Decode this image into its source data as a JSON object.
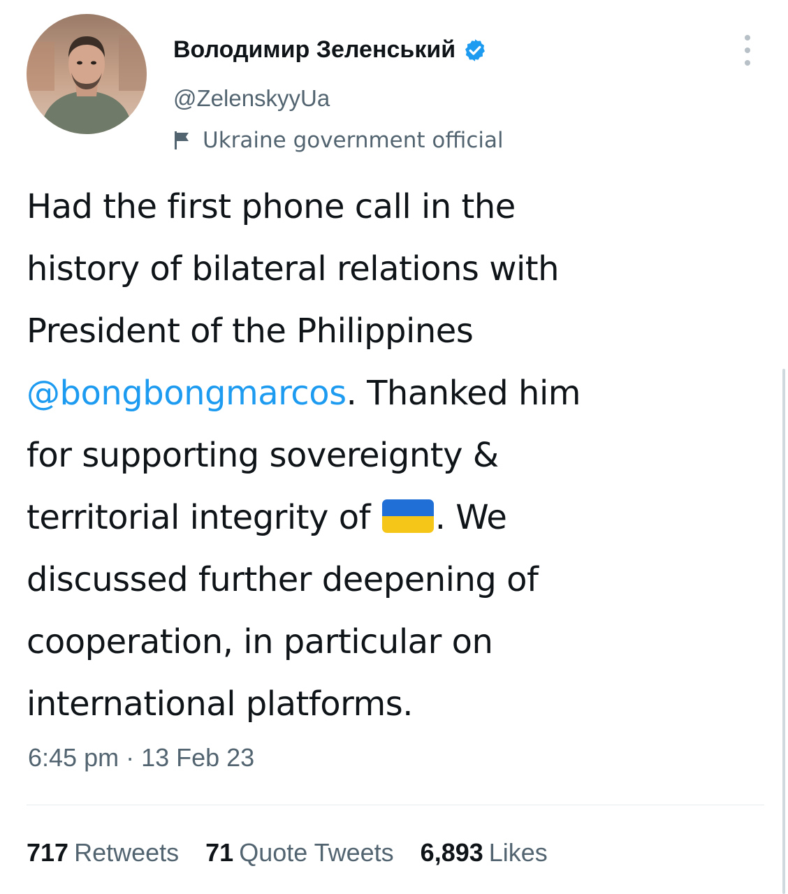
{
  "author": {
    "name": "Володимир Зеленський",
    "handle": "@ZelenskyyUa",
    "label": "Ukraine government official",
    "verified_color": "#1d9bf0"
  },
  "tweet": {
    "lines": [
      {
        "text": "Had the first phone call in the"
      },
      {
        "text": "history of bilateral relations with"
      },
      {
        "text": "President of the Philippines"
      },
      {
        "mention": "@bongbongmarcos",
        "after": ".  Thanked him"
      },
      {
        "text": "for supporting sovereignty &"
      },
      {
        "before": "territorial integrity of ",
        "emoji": "ukraine-flag",
        "after": ". We"
      },
      {
        "text": "discussed further deepening of"
      },
      {
        "text": "cooperation, in particular on"
      },
      {
        "text": "international platforms."
      }
    ],
    "timestamp": "6:45 pm · 13 Feb 23"
  },
  "stats": {
    "retweets_count": "717",
    "retweets_label": "Retweets",
    "quotes_count": "71",
    "quotes_label": "Quote Tweets",
    "likes_count": "6,893",
    "likes_label": "Likes"
  },
  "colors": {
    "link": "#1d9bf0",
    "secondary_text": "#536471",
    "flag_blue": "#1f6fd6",
    "flag_yellow": "#f5c518"
  }
}
